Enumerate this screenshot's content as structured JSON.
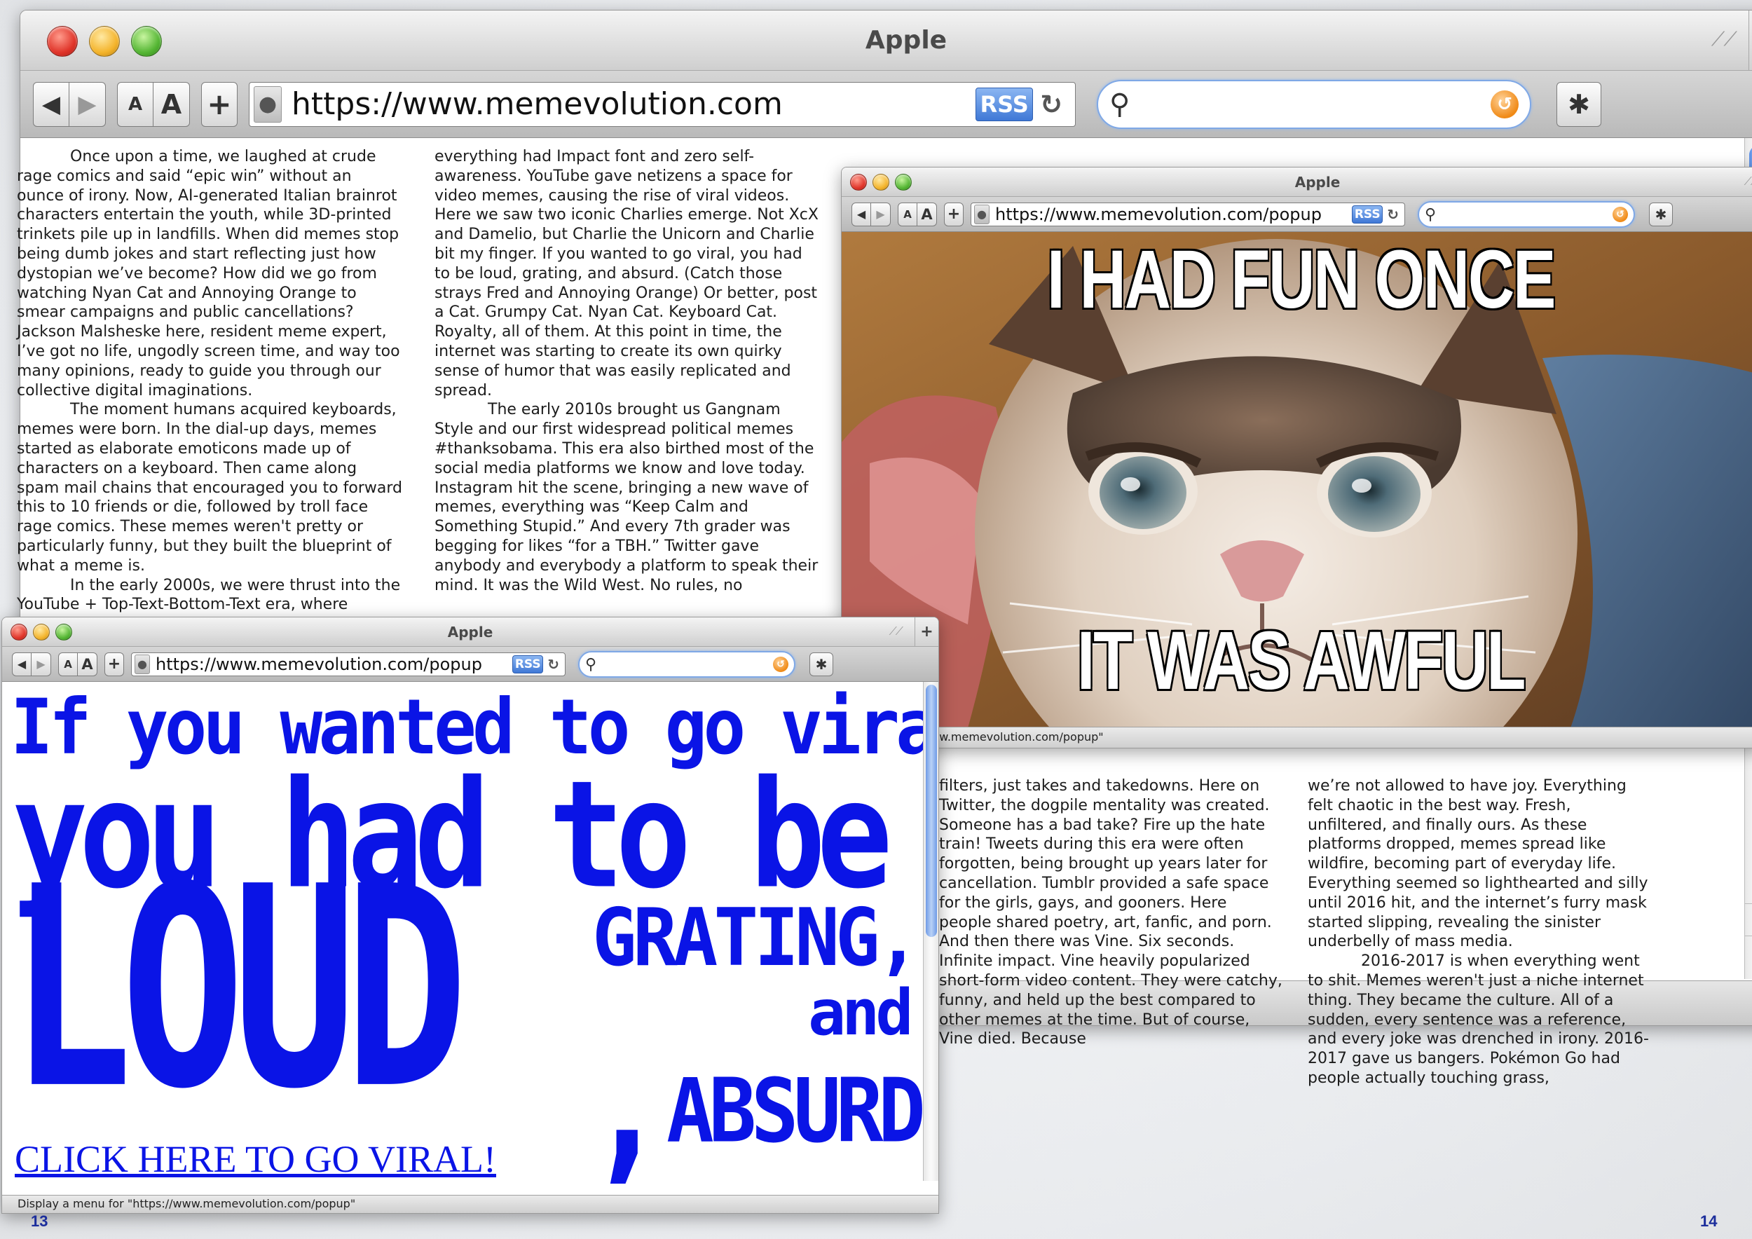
{
  "main_window": {
    "title": "Apple",
    "new_tab": "+",
    "url": "https://www.memevolution.com",
    "rss": "RSS",
    "back": "◀",
    "forward": "▶",
    "text_small": "A",
    "text_large": "A",
    "add": "+"
  },
  "article": {
    "col1": [
      "Once upon a time, we laughed at crude rage comics and said “epic win” without an ounce of irony. Now, AI-generated Italian brainrot characters entertain the youth, while 3D-printed trinkets pile up in landfills. When did memes stop being dumb jokes and start reflecting just how dystopian we’ve become? How did we go from watching Nyan Cat and Annoying Orange to smear campaigns and public cancellations? Jackson Malsheske here, resident meme expert, I’ve got no life, ungodly screen time, and way too many opinions, ready to guide you through our collective digital imaginations.",
      "The moment humans acquired keyboards, memes were born. In the dial-up days, memes started as elaborate emoticons made up of characters on a keyboard. Then came along spam mail chains that encouraged you to forward this to 10 friends or die, followed by troll face rage comics. These memes weren't pretty or particularly funny, but they built the blueprint of what a meme is.",
      "In the early 2000s, we were thrust into the YouTube + Top-Text-Bottom-Text era, where"
    ],
    "col2": [
      "everything had Impact font and zero self-awareness. YouTube gave netizens a space for video memes, causing the rise of viral videos. Here we saw two iconic Charlies emerge. Not XcX and Damelio, but Charlie the Unicorn and Charlie bit my finger. If you wanted to go viral, you had to be loud, grating, and absurd. (Catch those strays Fred and Annoying Orange) Or better, post a Cat. Grumpy Cat. Nyan Cat. Keyboard Cat. Royalty, all of them. At this point in time, the internet was starting to create its own quirky sense of humor that was easily replicated and spread.",
      "The early 2010s brought us Gangnam Style and our first widespread political memes #thanksobama. This era also birthed most of the social media platforms we know and love today. Instagram hit the scene, bringing a new wave of memes, everything was “Keep Calm and Something Stupid.”  And every 7th grader was begging for likes “for a TBH.” Twitter gave anybody and everybody a platform to speak their mind. It was the Wild West. No rules, no"
    ],
    "col3": "filters, just takes and takedowns. Here on Twitter, the dogpile mentality was created. Someone has a bad take? Fire up the hate train! Tweets during this era were often forgotten, being brought up years later for cancellation. Tumblr provided a safe space for the girls, gays, and gooners. Here people shared poetry, art, fanfic, and porn. And then there was Vine. Six seconds. Infinite impact. Vine heavily popularized short-form video content. They were catchy, funny, and held up the best compared to other memes at the time. But of course, Vine died. Because",
    "col4": [
      "we’re not allowed to have joy. Everything felt chaotic in the best way. Fresh, unfiltered, and finally ours. As these platforms dropped, memes spread like wildfire, becoming part of everyday life. Everything seemed so lighthearted and silly until 2016 hit, and the internet’s furry mask started slipping, revealing the sinister underbelly of mass media.",
      "2016-2017 is when everything went to shit. Memes weren't just a niche internet thing. They became the culture. All of a sudden, every sentence was a reference, and every joke was drenched in irony. 2016-2017 gave us bangers. Pokémon Go had people actually touching grass,"
    ]
  },
  "cat_popup": {
    "title": "Apple",
    "url": "https://www.memevolution.com/popup",
    "rss": "RSS",
    "meme_top": "I HAD FUN ONCE",
    "meme_bottom": "IT WAS AWFUL",
    "status": "u for \"https://www.memevolution.com/popup\""
  },
  "viral_popup": {
    "title": "Apple",
    "url": "https://www.memevolution.com/popup",
    "rss": "RSS",
    "line1": "If you wanted to go viral,",
    "line2": "you had to be",
    "line3": "LOUD",
    "line4": "GRATING,",
    "line5": "and",
    "line6": "ABSURD.",
    "semicolon": ",",
    "cta": "CLICK HERE TO GO VIRAL!",
    "status": "Display a menu for \"https://www.memevolution.com/popup\""
  },
  "page_numbers": {
    "left": "13",
    "right": "14"
  },
  "colors": {
    "accent_blue": "#0a14e6",
    "page_number": "#1c2e9c"
  }
}
